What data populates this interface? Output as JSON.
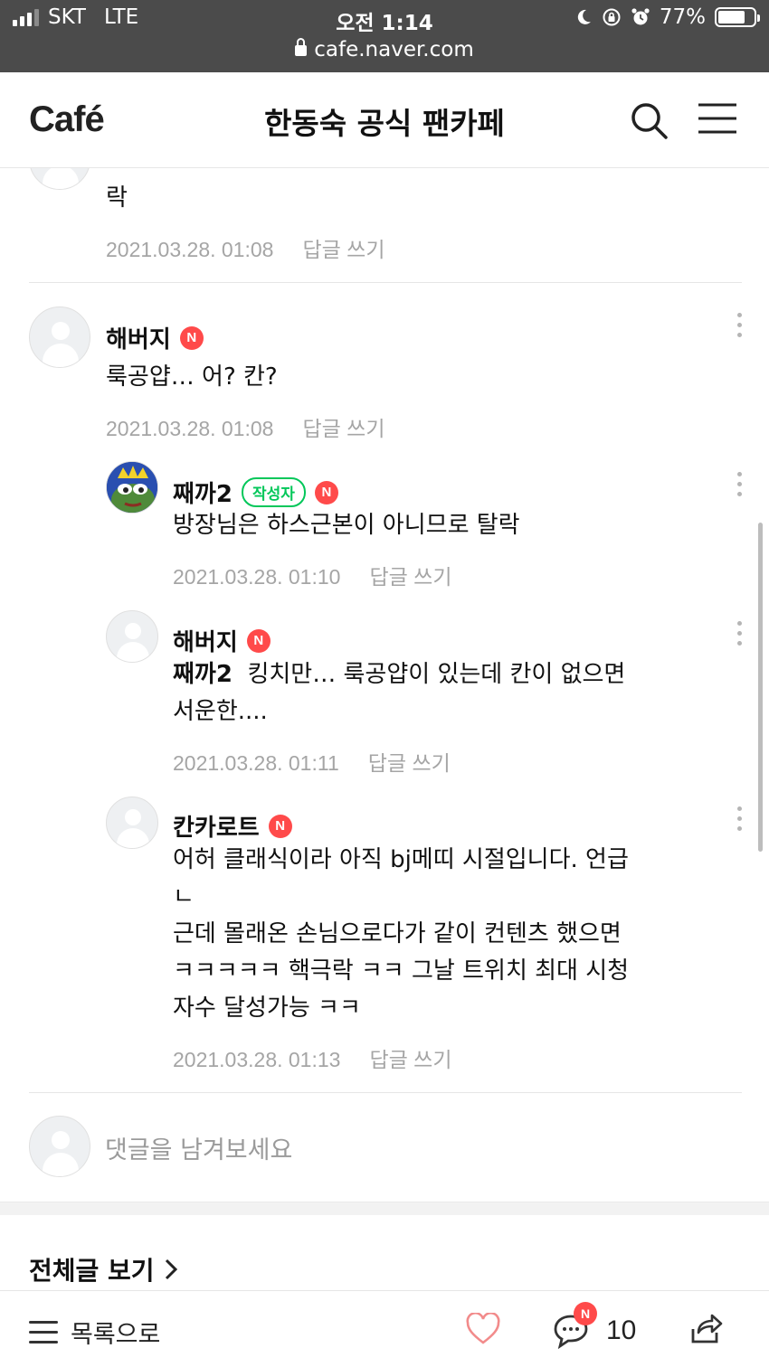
{
  "status_bar": {
    "carrier": "SKT",
    "network": "LTE",
    "time": "오전 1:14",
    "battery": "77%",
    "battery_level": 0.77,
    "url": "cafe.naver.com"
  },
  "header": {
    "logo": "Café",
    "title": "한동숙 공식 팬카페",
    "icons": [
      "search-icon",
      "menu-icon"
    ]
  },
  "comments": [
    {
      "text": "락",
      "date": "2021.03.28. 01:08",
      "reply": "답글 쓰기"
    },
    {
      "nick": "해버지",
      "badge": "N",
      "text": "룩공얍… 어? 칸?",
      "date": "2021.03.28. 01:08",
      "reply": "답글 쓰기"
    },
    {
      "nick": "째까2",
      "writer_badge": "작성자",
      "badge": "N",
      "text": "방장님은 하스근본이 아니므로 탈락",
      "date": "2021.03.28. 01:10",
      "reply": "답글 쓰기"
    },
    {
      "nick": "해버지",
      "badge": "N",
      "mention": "째까2",
      "text_line1": "킹치만… 룩공얍이 있는데 칸이 없으면",
      "text_line2": "서운한....",
      "date": "2021.03.28. 01:11",
      "reply": "답글 쓰기"
    },
    {
      "nick": "칸카로트",
      "badge": "N",
      "lines": [
        "어허 클래식이라 아직 bj메띠 시절입니다. 언급",
        "ㄴ",
        "근데 몰래온 손님으로다가 같이 컨텐츠 했으면",
        "ㅋㅋㅋㅋㅋ 핵극락 ㅋㅋ 그날 트위치 최대 시청",
        "자수 달성가능 ㅋㅋ"
      ],
      "date": "2021.03.28. 01:13",
      "reply": "답글 쓰기"
    }
  ],
  "write_comment": {
    "placeholder": "댓글을 남겨보세요"
  },
  "all_posts": "전체글 보기",
  "bottom_bar": {
    "list_label": "목록으로",
    "comment_badge": "N",
    "comment_count": "10"
  },
  "colors": {
    "accent_green": "#03c75a",
    "badge_red": "#ff4a4a",
    "statusbar_bg": "#4b4b4b"
  }
}
